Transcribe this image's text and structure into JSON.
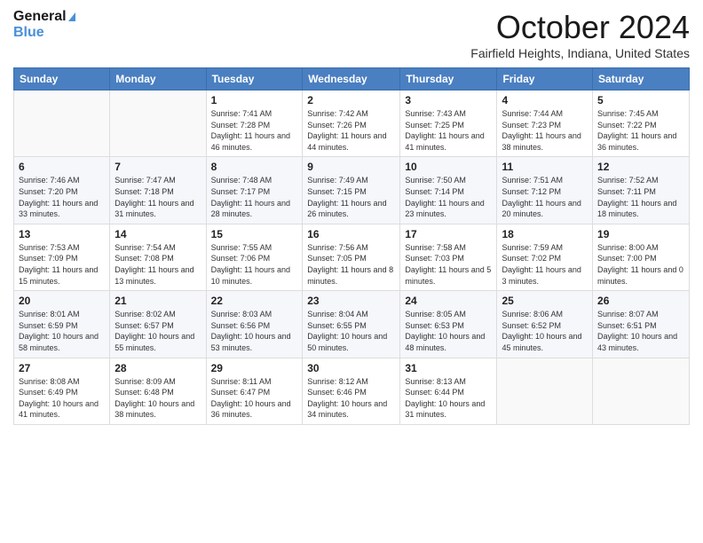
{
  "logo": {
    "line1": "General",
    "line2": "Blue"
  },
  "header": {
    "month": "October 2024",
    "location": "Fairfield Heights, Indiana, United States"
  },
  "days_of_week": [
    "Sunday",
    "Monday",
    "Tuesday",
    "Wednesday",
    "Thursday",
    "Friday",
    "Saturday"
  ],
  "weeks": [
    [
      {
        "day": "",
        "info": ""
      },
      {
        "day": "",
        "info": ""
      },
      {
        "day": "1",
        "info": "Sunrise: 7:41 AM\nSunset: 7:28 PM\nDaylight: 11 hours and 46 minutes."
      },
      {
        "day": "2",
        "info": "Sunrise: 7:42 AM\nSunset: 7:26 PM\nDaylight: 11 hours and 44 minutes."
      },
      {
        "day": "3",
        "info": "Sunrise: 7:43 AM\nSunset: 7:25 PM\nDaylight: 11 hours and 41 minutes."
      },
      {
        "day": "4",
        "info": "Sunrise: 7:44 AM\nSunset: 7:23 PM\nDaylight: 11 hours and 38 minutes."
      },
      {
        "day": "5",
        "info": "Sunrise: 7:45 AM\nSunset: 7:22 PM\nDaylight: 11 hours and 36 minutes."
      }
    ],
    [
      {
        "day": "6",
        "info": "Sunrise: 7:46 AM\nSunset: 7:20 PM\nDaylight: 11 hours and 33 minutes."
      },
      {
        "day": "7",
        "info": "Sunrise: 7:47 AM\nSunset: 7:18 PM\nDaylight: 11 hours and 31 minutes."
      },
      {
        "day": "8",
        "info": "Sunrise: 7:48 AM\nSunset: 7:17 PM\nDaylight: 11 hours and 28 minutes."
      },
      {
        "day": "9",
        "info": "Sunrise: 7:49 AM\nSunset: 7:15 PM\nDaylight: 11 hours and 26 minutes."
      },
      {
        "day": "10",
        "info": "Sunrise: 7:50 AM\nSunset: 7:14 PM\nDaylight: 11 hours and 23 minutes."
      },
      {
        "day": "11",
        "info": "Sunrise: 7:51 AM\nSunset: 7:12 PM\nDaylight: 11 hours and 20 minutes."
      },
      {
        "day": "12",
        "info": "Sunrise: 7:52 AM\nSunset: 7:11 PM\nDaylight: 11 hours and 18 minutes."
      }
    ],
    [
      {
        "day": "13",
        "info": "Sunrise: 7:53 AM\nSunset: 7:09 PM\nDaylight: 11 hours and 15 minutes."
      },
      {
        "day": "14",
        "info": "Sunrise: 7:54 AM\nSunset: 7:08 PM\nDaylight: 11 hours and 13 minutes."
      },
      {
        "day": "15",
        "info": "Sunrise: 7:55 AM\nSunset: 7:06 PM\nDaylight: 11 hours and 10 minutes."
      },
      {
        "day": "16",
        "info": "Sunrise: 7:56 AM\nSunset: 7:05 PM\nDaylight: 11 hours and 8 minutes."
      },
      {
        "day": "17",
        "info": "Sunrise: 7:58 AM\nSunset: 7:03 PM\nDaylight: 11 hours and 5 minutes."
      },
      {
        "day": "18",
        "info": "Sunrise: 7:59 AM\nSunset: 7:02 PM\nDaylight: 11 hours and 3 minutes."
      },
      {
        "day": "19",
        "info": "Sunrise: 8:00 AM\nSunset: 7:00 PM\nDaylight: 11 hours and 0 minutes."
      }
    ],
    [
      {
        "day": "20",
        "info": "Sunrise: 8:01 AM\nSunset: 6:59 PM\nDaylight: 10 hours and 58 minutes."
      },
      {
        "day": "21",
        "info": "Sunrise: 8:02 AM\nSunset: 6:57 PM\nDaylight: 10 hours and 55 minutes."
      },
      {
        "day": "22",
        "info": "Sunrise: 8:03 AM\nSunset: 6:56 PM\nDaylight: 10 hours and 53 minutes."
      },
      {
        "day": "23",
        "info": "Sunrise: 8:04 AM\nSunset: 6:55 PM\nDaylight: 10 hours and 50 minutes."
      },
      {
        "day": "24",
        "info": "Sunrise: 8:05 AM\nSunset: 6:53 PM\nDaylight: 10 hours and 48 minutes."
      },
      {
        "day": "25",
        "info": "Sunrise: 8:06 AM\nSunset: 6:52 PM\nDaylight: 10 hours and 45 minutes."
      },
      {
        "day": "26",
        "info": "Sunrise: 8:07 AM\nSunset: 6:51 PM\nDaylight: 10 hours and 43 minutes."
      }
    ],
    [
      {
        "day": "27",
        "info": "Sunrise: 8:08 AM\nSunset: 6:49 PM\nDaylight: 10 hours and 41 minutes."
      },
      {
        "day": "28",
        "info": "Sunrise: 8:09 AM\nSunset: 6:48 PM\nDaylight: 10 hours and 38 minutes."
      },
      {
        "day": "29",
        "info": "Sunrise: 8:11 AM\nSunset: 6:47 PM\nDaylight: 10 hours and 36 minutes."
      },
      {
        "day": "30",
        "info": "Sunrise: 8:12 AM\nSunset: 6:46 PM\nDaylight: 10 hours and 34 minutes."
      },
      {
        "day": "31",
        "info": "Sunrise: 8:13 AM\nSunset: 6:44 PM\nDaylight: 10 hours and 31 minutes."
      },
      {
        "day": "",
        "info": ""
      },
      {
        "day": "",
        "info": ""
      }
    ]
  ]
}
